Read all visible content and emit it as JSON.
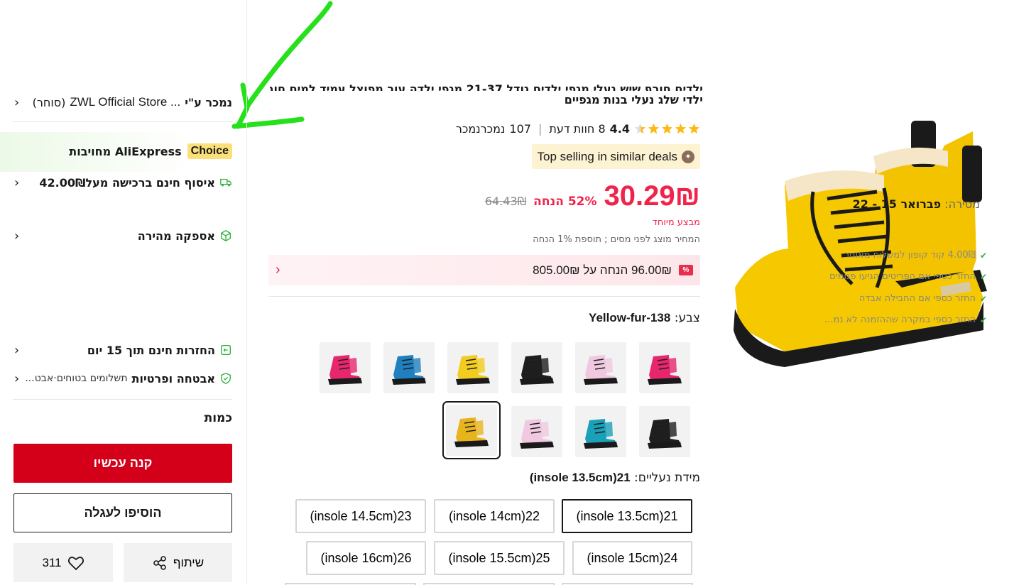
{
  "product": {
    "title_line1": "ילדים חורף שיש נעלי מגפי ילדים גודל 21-37 מגפי ילדה עור מפוצל עמיד למים חורף",
    "title_line2": "ילדי שלג נעלי בנות מגפיים",
    "rating": "4.4",
    "reviews": "8 חוות דעת",
    "sold_count": "107",
    "sold_label": "נמכרנמכר",
    "top_selling": "Top selling in similar deals",
    "price": "30.29₪",
    "discount": "52% הנחה",
    "old_price": "64.43₪",
    "special_offer": "מבצע מיוחד",
    "tax_note": "המחיר מוצג לפני מסים ; תוספת 1% הנחה",
    "coupon_text": "96.00₪ הנחה על 805.00₪",
    "coupon_badge": "%",
    "color_label": "צבע: ",
    "color_value": "Yellow-fur-138",
    "size_label": "מידת נעליים: ",
    "size_value": "21(insole 13.5cm)",
    "sizes": [
      "21(insole 13.5cm)",
      "22(insole 14cm)",
      "23(insole 14.5cm)",
      "24(insole 15cm)",
      "25(insole 15.5cm)",
      "26(insole 16cm)"
    ],
    "swatch_colors": [
      "#e8266e",
      "#f0c8e0",
      "#1e1e1e",
      "#f2cc1e",
      "#1f7fbf",
      "#e8266e",
      "#1e1e1e",
      "#1aa0b8",
      "#f0c8e0",
      "#e8b41e"
    ]
  },
  "seller": {
    "prefix": "נמכר ע\"י",
    "name": "ZWL Official Store ...",
    "tag": "(סוחר)"
  },
  "choice": {
    "badge": "Choice",
    "text": "AliExpress מחויבות"
  },
  "shipping": {
    "title": "איסוף חינם ברכישה מעל42.00₪",
    "delivery_label": "מסירה: ",
    "delivery_value": "פברואר 15 - 22"
  },
  "fast_delivery": {
    "title": "אספקה מהירה",
    "items": [
      "4.00₪ קוד קופון למשלוח מאוחר",
      "החזר כספי אם הפריטים הגיעו פגומים",
      "החזר כספי אם החבילה אבדה",
      "החזר כספי במקרה שההזמנה לא נמ..."
    ]
  },
  "returns": {
    "title": "החזרות חינם תוך 15 יום"
  },
  "security": {
    "title": "אבטחה ופרטיות",
    "subtitle": "תשלומים בטוחים·אבט..."
  },
  "quantity_label": "כמות",
  "buttons": {
    "buy_now": "קנה עכשיו",
    "add_cart": "הוסיפו לעגלה",
    "share": "שיתוף",
    "wishlist_count": "311"
  },
  "colors": {
    "accent": "#f2234b",
    "buy": "#d40019",
    "choice": "#fbe07a",
    "green": "#2db33b",
    "annotation": "#27e01c"
  }
}
